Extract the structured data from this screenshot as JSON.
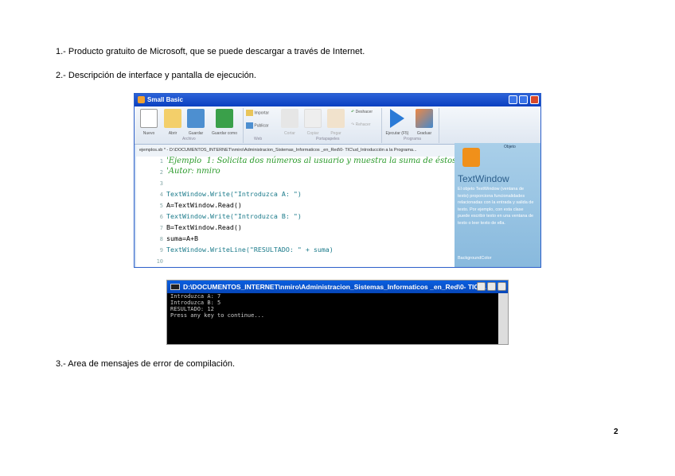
{
  "paragraphs": [
    "1.- Producto gratuito de Microsoft, que se puede descargar a través de Internet.",
    "2.- Descripción de interface y pantalla de ejecución.",
    "3.- Area de mensajes de error de compilación."
  ],
  "page_number": "2",
  "small_basic": {
    "title": "Small Basic",
    "ribbon": {
      "buttons": [
        "Nuevo",
        "Abrir",
        "Guardar",
        "Guardar como",
        "Importar",
        "Publicar",
        "Cortar",
        "Copiar",
        "Pegar",
        "Deshacer",
        "Rehacer",
        "Ejecutar (F5)",
        "Graduar"
      ],
      "groups": [
        "Archivo",
        "Web",
        "Portapapeles",
        "Programa"
      ]
    },
    "doc_tab": "ejemplos.sb * - D:\\DOCUMENTOS_INTERNET\\nmiro\\Administracion_Sistemas_Informaticos _en_Red\\0- TIC\\ud_Introducción a la Programa...",
    "code": [
      {
        "n": "1",
        "t": "'Ejemplo  1: Solicita dos números al usuario y muestra la suma de éstos."
      },
      {
        "n": "2",
        "t": "'Autor: nmiro"
      },
      {
        "n": "3",
        "t": ""
      },
      {
        "n": "4",
        "t": "TextWindow.Write(\"Introduzca A: \")"
      },
      {
        "n": "5",
        "t": "A=TextWindow.Read()"
      },
      {
        "n": "6",
        "t": "TextWindow.Write(\"Introduzca B: \")"
      },
      {
        "n": "7",
        "t": "B=TextWindow.Read()"
      },
      {
        "n": "8",
        "t": "suma=A+B"
      },
      {
        "n": "9",
        "t": "TextWindow.WriteLine(\"RESULTADO: \" + suma)"
      },
      {
        "n": "10",
        "t": ""
      }
    ],
    "help": {
      "label": "Objeto",
      "title": "TextWindow",
      "text": "El objeto TextWindow (ventana de texto) proporciona funcionalidades relacionadas con la entrada y salida de texto. Por ejemplo, con esta clase puede escribir texto en una ventana de texto o leer texto de ella.",
      "property": "BackgroundColor"
    }
  },
  "console": {
    "title": "D:\\DOCUMENTOS_INTERNET\\nmiro\\Administracion_Sistemas_Informaticos _en_Red\\0- TIC\\...",
    "lines": [
      "Introduzca A: 7",
      "Introduzca B: 5",
      "RESULTADO: 12",
      "Press any key to continue..."
    ]
  }
}
